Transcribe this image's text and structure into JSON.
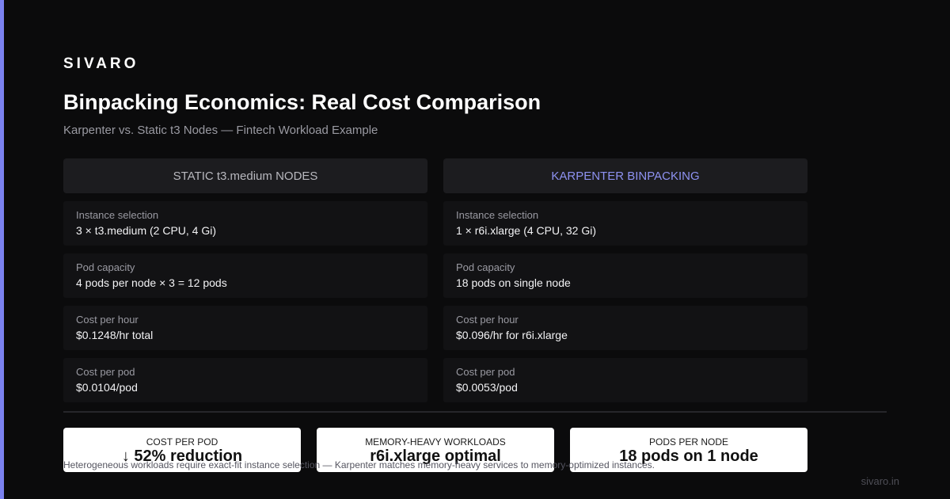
{
  "brand": "SIVARO",
  "title": "Binpacking Economics: Real Cost Comparison",
  "subtitle": "Karpenter vs. Static t3 Nodes — Fintech Workload Example",
  "accent_color": "#7b82f0",
  "comparison": {
    "left": {
      "header": "STATIC t3.medium NODES",
      "rows": [
        {
          "label": "Instance selection",
          "value": "3 × t3.medium (2 CPU, 4 Gi)"
        },
        {
          "label": "Pod capacity",
          "value": "4 pods per node × 3 = 12 pods"
        },
        {
          "label": "Cost per hour",
          "value": "$0.1248/hr total"
        },
        {
          "label": "Cost per pod",
          "value": "$0.0104/pod"
        }
      ]
    },
    "right": {
      "header": "KARPENTER BINPACKING",
      "rows": [
        {
          "label": "Instance selection",
          "value": "1 × r6i.xlarge (4 CPU, 32 Gi)"
        },
        {
          "label": "Pod capacity",
          "value": "18 pods on single node"
        },
        {
          "label": "Cost per hour",
          "value": "$0.096/hr for r6i.xlarge"
        },
        {
          "label": "Cost per pod",
          "value": "$0.0053/pod"
        }
      ]
    }
  },
  "stats": [
    {
      "label": "COST PER POD",
      "value": "↓ 52% reduction"
    },
    {
      "label": "MEMORY-HEAVY WORKLOADS",
      "value": "r6i.xlarge optimal"
    },
    {
      "label": "PODS PER NODE",
      "value": "18 pods on 1 node"
    }
  ],
  "footnote": "Heterogeneous workloads require exact-fit instance selection — Karpenter matches memory-heavy services to memory-optimized instances.",
  "site": "sivaro.in"
}
